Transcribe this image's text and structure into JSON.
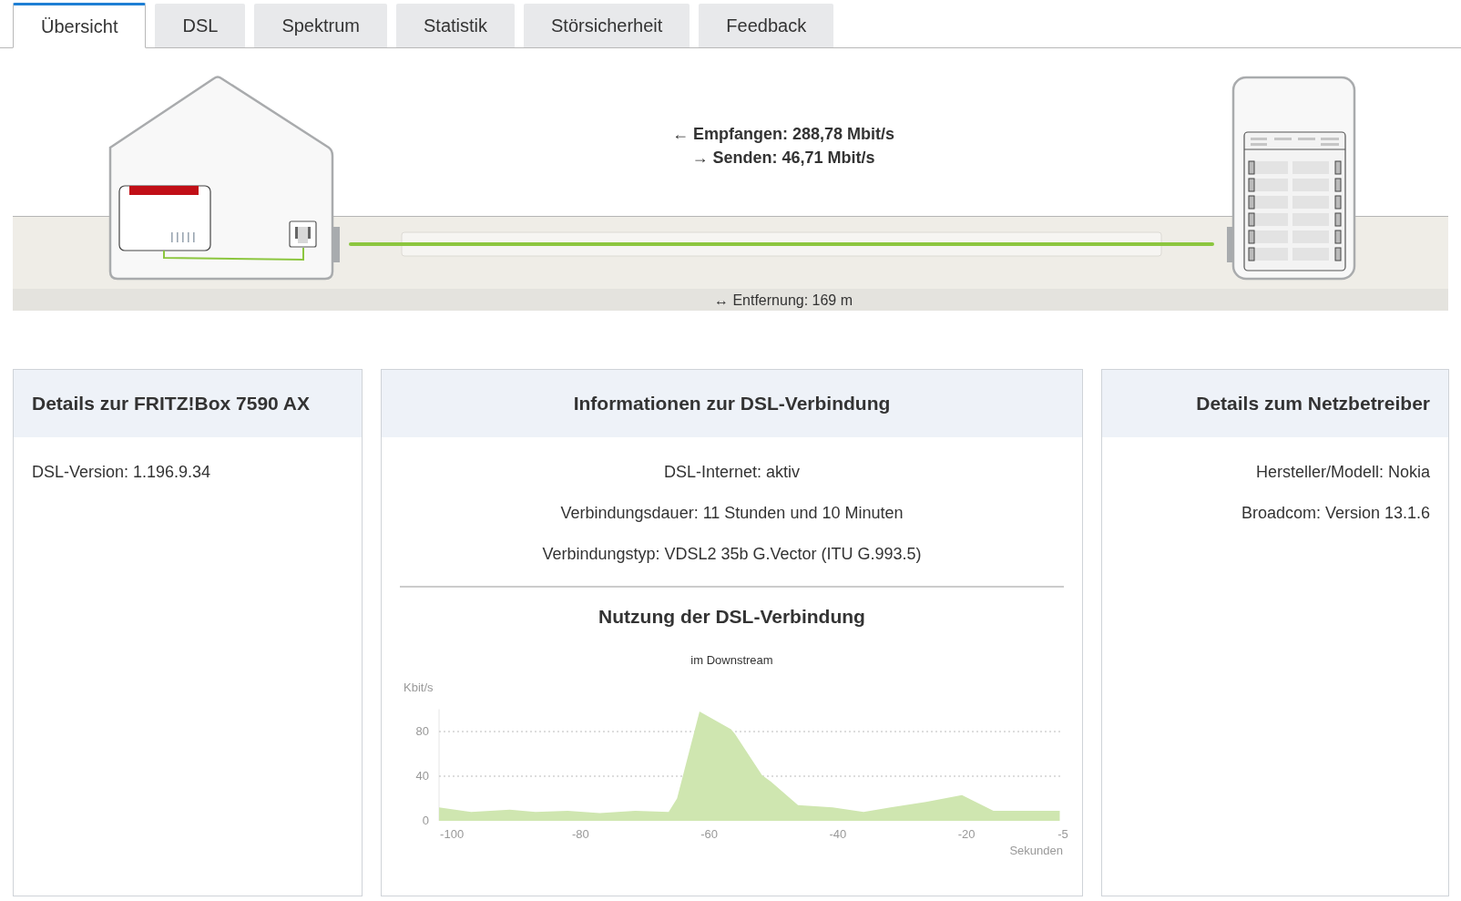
{
  "tabs": [
    {
      "label": "Übersicht",
      "selected": true
    },
    {
      "label": "DSL",
      "selected": false
    },
    {
      "label": "Spektrum",
      "selected": false
    },
    {
      "label": "Statistik",
      "selected": false
    },
    {
      "label": "Störsicherheit",
      "selected": false
    },
    {
      "label": "Feedback",
      "selected": false
    }
  ],
  "line": {
    "receive": "← Empfangen: 288,78 Mbit/s",
    "send": "→ Senden: 46,71 Mbit/s",
    "distance": "↔ Entfernung: 169 m",
    "connected": true
  },
  "cards": [
    {
      "kind": "device",
      "title": "Details zur FRITZ!Box 7590 AX",
      "lines": [
        "DSL-Version: 1.196.9.34"
      ]
    },
    {
      "kind": "connection",
      "title": "Informationen zur DSL-Verbindung",
      "lines": [
        "DSL-Internet: aktiv",
        "Verbindungsdauer: 11 Stunden und 10 Minuten",
        "Verbindungstyp: VDSL2 35b G.Vector (ITU G.993.5)"
      ],
      "usage": {
        "title": "Nutzung der DSL-Verbindung",
        "chart_data": {
          "type": "area",
          "title": "im Downstream",
          "xlabel": "Sekunden",
          "ylabel": "Kbit/s",
          "x": [
            -102,
            -97,
            -91,
            -87,
            -82,
            -77,
            -71.5,
            -66.3,
            -65,
            -61.5,
            -56.6,
            -56,
            -51.8,
            -50.4,
            -46.2,
            -40.8,
            -36,
            -31.8,
            -26.3,
            -20.7,
            -15.8,
            -5.5
          ],
          "series": [
            {
              "color": "#cfe6b0",
              "values": [
                12,
                8,
                10,
                8,
                9,
                7,
                9,
                8,
                20,
                98,
                82,
                78,
                41,
                35,
                14,
                12,
                8,
                12,
                17,
                23,
                9,
                9
              ]
            }
          ],
          "xlim": [
            -102,
            -5
          ],
          "ylim": [
            0,
            100
          ],
          "xticks": [
            -100,
            -80,
            -60,
            -40,
            -20,
            -5
          ],
          "yticks": [
            0,
            40,
            80
          ]
        }
      }
    },
    {
      "kind": "provider",
      "title": "Details zum Netzbetreiber",
      "lines": [
        "Hersteller/Modell: Nokia",
        "Broadcom: Version 13.1.6"
      ]
    }
  ]
}
